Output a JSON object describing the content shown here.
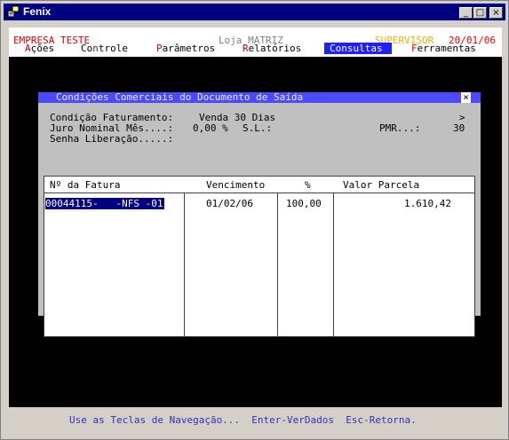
{
  "window": {
    "title": "Fenix",
    "buttons": {
      "minimize": "_",
      "maximize": "□",
      "close": "×"
    }
  },
  "header": {
    "company": "EMPRESA TESTE",
    "store": "Loja MATRIZ",
    "user": "SUPERVISOR",
    "date": "20/01/06"
  },
  "menu": [
    {
      "hot": "A",
      "rest": "ções"
    },
    {
      "hot": "C",
      "rest": "ontrole",
      "prefix": ""
    },
    {
      "hot": "P",
      "rest": "arâmetros"
    },
    {
      "hot": "R",
      "rest": "elatórios"
    },
    {
      "label": "Consultas"
    },
    {
      "hot": "F",
      "rest": "erramentas"
    }
  ],
  "menu_labels": {
    "acoes_prefix": "",
    "controle_prefix": "Co",
    "controle_hot": "n",
    "controle_rest": "trole"
  },
  "dialog": {
    "title": "Condições Comerciais do Documento de Saída",
    "close": "×",
    "condicao_label": "Condição Faturamento:",
    "condicao_value": "Venda 30 Dias",
    "arrow": ">",
    "juro_label": "Juro Nominal Mês....:",
    "juro_value": "0,00 %",
    "sl_label": "S.L.:",
    "pmr_label": "PMR...:",
    "pmr_value": "30",
    "senha_label": "Senha Liberação.....:",
    "table": {
      "headers": [
        "Nº da Fatura",
        "Vencimento",
        "%",
        "Valor Parcela"
      ],
      "rows": [
        {
          "fatura": "00044115-   -NFS -01",
          "vencimento": "01/02/06",
          "percent": "100,00",
          "valor": "1.610,42"
        }
      ]
    }
  },
  "status_bar": "Use as Teclas de Navegação...  Enter-VerDados  Esc-Retorna.",
  "colors": {
    "titlebar": "#000080",
    "menu_hot": "#e00000",
    "menu_selected": "#2020ff",
    "dialog_title": "#4a4aff",
    "supervisor": "#f0b000",
    "status": "#3030c0"
  }
}
